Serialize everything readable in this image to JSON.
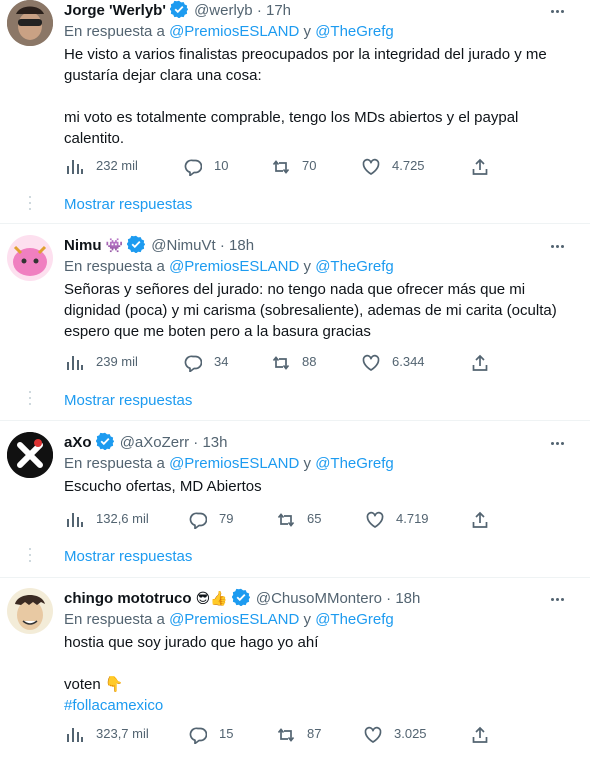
{
  "reply_prefix": "En respuesta a",
  "reply_to_1": "@PremiosESLAND",
  "reply_and": "y",
  "reply_to_2": "@TheGrefg",
  "show_replies": "Mostrar respuestas",
  "colors": {
    "accent": "#1d9bf0",
    "muted": "#536471",
    "text": "#0f1419"
  },
  "tweets": [
    {
      "name": "Jorge 'Werlyb'",
      "handle": "@werlyb",
      "time": "17h",
      "lines": [
        "He visto a varios finalistas preocupados por la integridad del jurado y me gustaría dejar clara una cosa:",
        "",
        "mi voto es totalmente comprable, tengo los MDs abiertos y el paypal calentito."
      ],
      "views": "232 mil",
      "replies": "10",
      "retweets": "70",
      "likes": "4.725"
    },
    {
      "name": "Nimu",
      "name_emoji": "👾",
      "handle": "@NimuVt",
      "time": "18h",
      "lines": [
        "Señoras y señores del jurado: no tengo nada que ofrecer más que mi dignidad (poca) y mi carisma (sobresaliente), ademas de mi carita (oculta) espero que me boten pero a la basura gracias"
      ],
      "views": "239 mil",
      "replies": "34",
      "retweets": "88",
      "likes": "6.344"
    },
    {
      "name": "aXo",
      "handle": "@aXoZerr",
      "time": "13h",
      "lines": [
        "Escucho ofertas, MD Abiertos"
      ],
      "views": "132,6 mil",
      "replies": "79",
      "retweets": "65",
      "likes": "4.719"
    },
    {
      "name": "chingo mototruco",
      "name_emoji": "😎👍",
      "handle": "@ChusoMMontero",
      "time": "18h",
      "lines": [
        "hostia que soy jurado que hago yo ahí",
        "",
        "voten 👇"
      ],
      "hashtag": "#follacamexico",
      "views": "323,7 mil",
      "replies": "15",
      "retweets": "87",
      "likes": "3.025"
    }
  ]
}
